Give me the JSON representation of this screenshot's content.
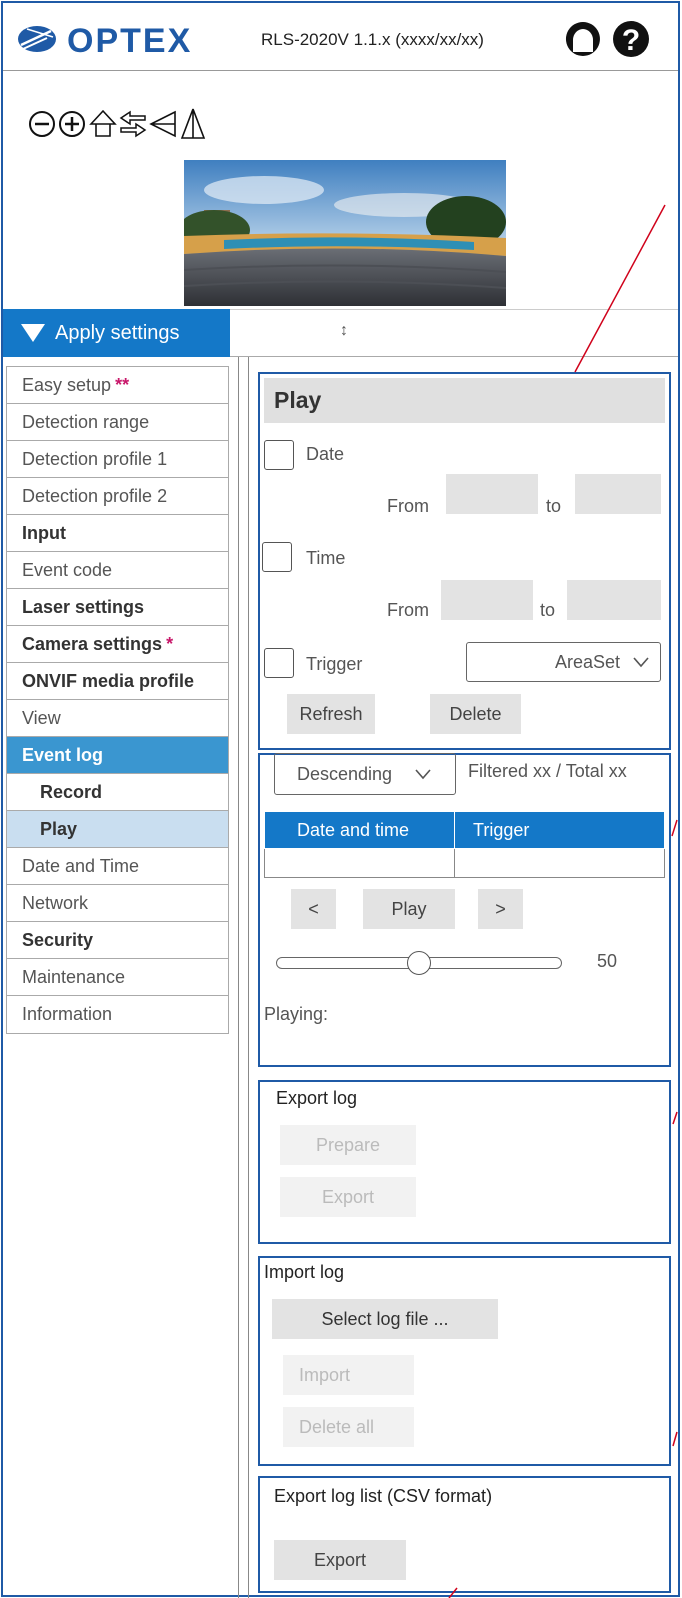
{
  "header": {
    "logo_text": "OPTEX",
    "model": "RLS-2020V 1.1.x (xxxx/xx/xx)",
    "icons": [
      "account-icon",
      "help-icon"
    ]
  },
  "toolbar": {
    "icons": [
      "zoom-out-icon",
      "zoom-in-icon",
      "home-icon",
      "swap-icon",
      "flip-icon",
      "mirror-icon"
    ]
  },
  "apply": {
    "label": "Apply settings",
    "resize_glyph": "↕"
  },
  "menu": {
    "items": [
      {
        "label": "Easy setup",
        "mark": "**"
      },
      {
        "label": "Detection range"
      },
      {
        "label": "Detection profile 1"
      },
      {
        "label": "Detection profile 2"
      },
      {
        "label": "Input"
      },
      {
        "label": "Event code"
      },
      {
        "label": "Laser settings"
      },
      {
        "label": "Camera settings",
        "mark": "*"
      },
      {
        "label": "ONVIF media profile"
      },
      {
        "label": "View"
      },
      {
        "label": "Event log"
      },
      {
        "label": "Record"
      },
      {
        "label": "Play"
      },
      {
        "label": "Date and Time"
      },
      {
        "label": "Network"
      },
      {
        "label": "Security"
      },
      {
        "label": "Maintenance"
      },
      {
        "label": "Information"
      }
    ]
  },
  "play": {
    "title": "Play",
    "date_label": "Date",
    "time_label": "Time",
    "trigger_label": "Trigger",
    "from": "From",
    "to": "to",
    "trigger_select": "AreaSet",
    "refresh": "Refresh",
    "delete": "Delete"
  },
  "list": {
    "order_select": "Descending",
    "filter_text": "Filtered xx / Total xx",
    "columns": [
      "Date and time",
      "Trigger"
    ],
    "prev": "<",
    "play": "Play",
    "next": ">",
    "slider_value": "50",
    "playing_label": "Playing:"
  },
  "export_log": {
    "title": "Export log",
    "prepare": "Prepare",
    "export": "Export"
  },
  "import_log": {
    "title": "Import log",
    "select": "Select log file ...",
    "import": "Import",
    "delete_all": "Delete all"
  },
  "csv": {
    "title": "Export log list (CSV format)",
    "export": "Export"
  },
  "colors": {
    "accent": "#1478c8",
    "frame": "#1f5aa6",
    "active_menu": "#3a96d0",
    "sub_selected": "#c9def0",
    "mark": "#c8186a"
  }
}
